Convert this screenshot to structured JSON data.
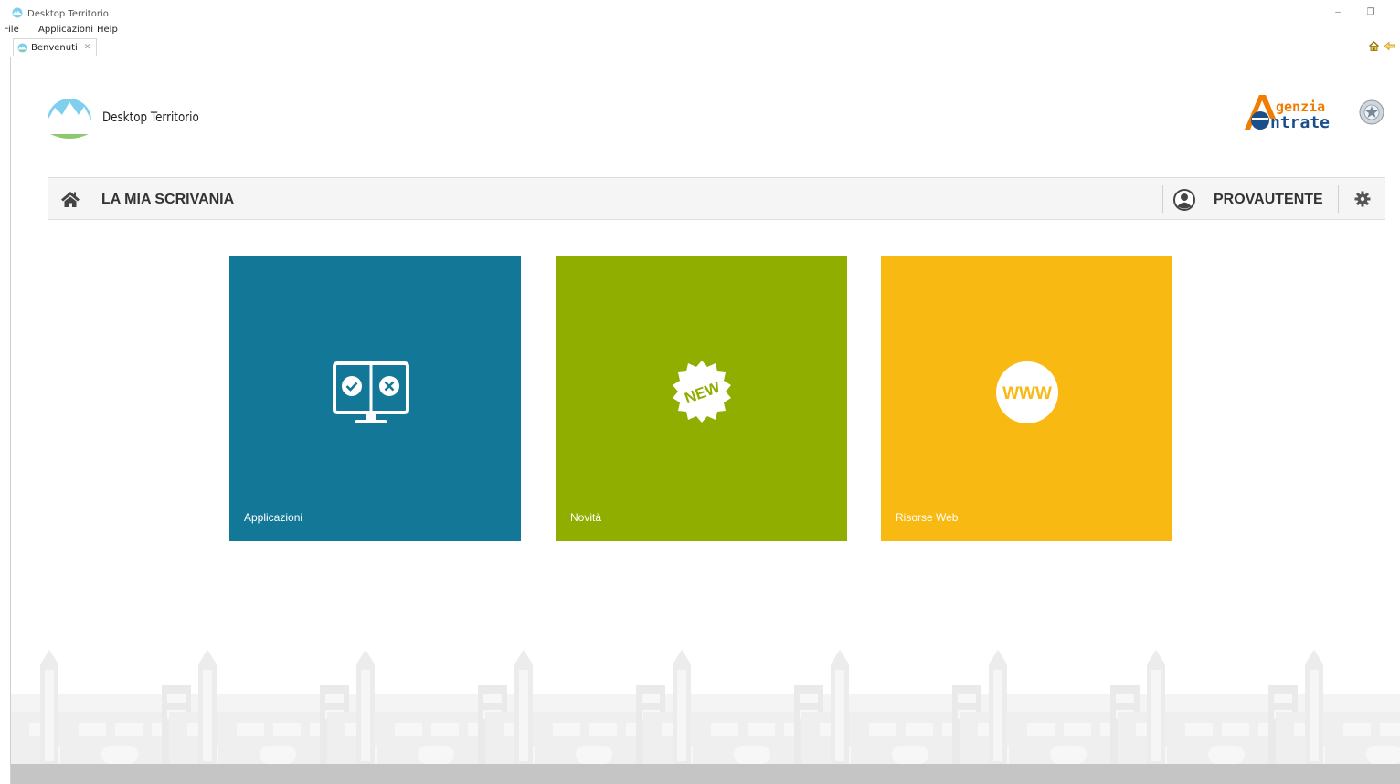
{
  "window": {
    "title": "Desktop Territorio",
    "minimize_glyph": "–",
    "restore_glyph": "❐"
  },
  "menu": [
    "File",
    "Applicazioni",
    "Help"
  ],
  "tab": {
    "label": "Benvenuti",
    "close_glyph": "✕"
  },
  "header": {
    "app_name": "Desktop Territorio",
    "agency_logo_text": [
      "genzia",
      "ntrate"
    ]
  },
  "nav": {
    "title": "LA MIA SCRIVANIA",
    "username": "PROVAUTENTE"
  },
  "tiles": [
    {
      "label": "Applicazioni",
      "color": "#137898",
      "icon": "monitor-check-cross-icon"
    },
    {
      "label": "Novità",
      "color": "#8fae00",
      "icon": "new-badge-icon",
      "badge_text": "NEW"
    },
    {
      "label": "Risorse Web",
      "color": "#f8b912",
      "icon": "www-icon",
      "badge_text": "WWW"
    }
  ],
  "colors": {
    "accent_blue": "#137898",
    "accent_green": "#8fae00",
    "accent_yellow": "#f8b912",
    "logo_sky": "#7fd0ee",
    "logo_grass": "#8cc86f",
    "agency_orange": "#f07d00",
    "agency_blue": "#1b4f8c"
  }
}
